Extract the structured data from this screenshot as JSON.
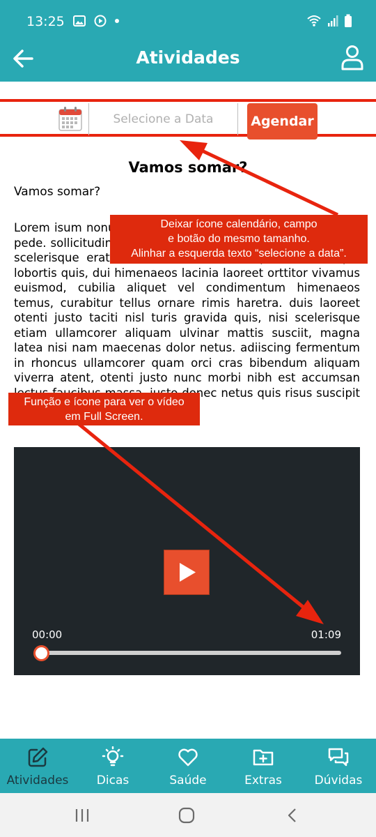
{
  "status_bar": {
    "time": "13:25"
  },
  "app_bar": {
    "title": "Atividades"
  },
  "date_row": {
    "placeholder": "Selecione a Data",
    "schedule_label": "Agendar"
  },
  "content": {
    "title": "Vamos somar?",
    "subtitle": "Vamos somar?",
    "body": "Lorem isum nonummy vivamus quis tincidunt. netus donec pede. sollicitudin, metus lobortis hac ipsum lacus, praesent scelerisque erat vehicula, velit viverra. pretium tristique lobortis quis, dui himenaeos lacinia laoreet orttitor vivamus euismod, cubilia aliquet vel condimentum himenaeos temus, curabitur tellus ornare rimis haretra. duis laoreet otenti justo taciti nisl turis gravida quis, nisi scelerisque etiam ullamcorer aliquam ulvinar mattis susciit, magna latea nisi nam maecenas dolor netus. adiiscing fermentum in rhoncus ullamcorer quam orci cras bibendum aliquam viverra atent, otenti justo nunc morbi nibh est accumsan lectus faucibus massa, justo donec netus quis risus suscipit lectus tortor aliquam ut."
  },
  "annotations": {
    "first_line1": "Deixar ícone calendário, campo",
    "first_line2": "e botão do mesmo tamanho.",
    "first_line3": "Alinhar a esquerda texto “selecione a data”.",
    "second_line1": "Função e ícone para ver o vídeo",
    "second_line2": "em Full Screen."
  },
  "video": {
    "current_time": "00:00",
    "duration": "01:09",
    "progress": 0
  },
  "bottom_nav": {
    "items": [
      {
        "label": "Atividades",
        "icon": "edit-icon",
        "active": true
      },
      {
        "label": "Dicas",
        "icon": "lightbulb-icon",
        "active": false
      },
      {
        "label": "Saúde",
        "icon": "heart-icon",
        "active": false
      },
      {
        "label": "Extras",
        "icon": "folder-plus-icon",
        "active": false
      },
      {
        "label": "Dúvidas",
        "icon": "chat-icon",
        "active": false
      }
    ]
  },
  "colors": {
    "primary": "#29a9b3",
    "accent": "#e84f2d",
    "annotation": "#de2a0d",
    "video_bg": "#20262a"
  }
}
